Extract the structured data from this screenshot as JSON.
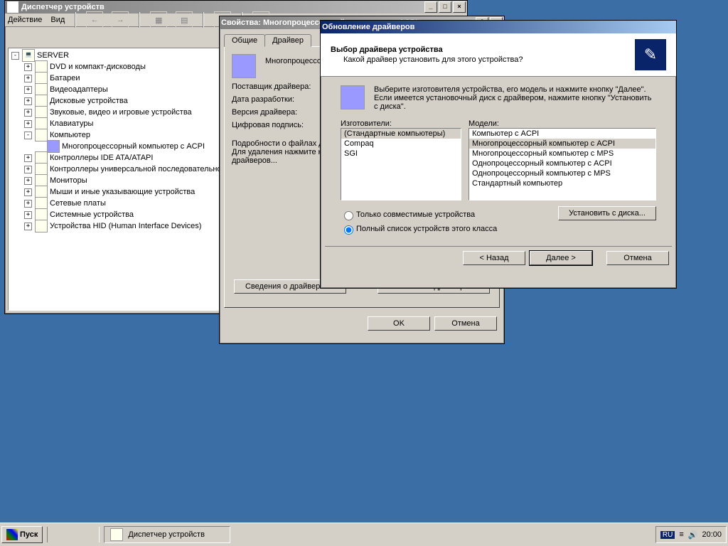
{
  "devmgr": {
    "title": "Диспетчер устройств",
    "menus": {
      "action": "Действие",
      "view": "Вид"
    },
    "root": "SERVER",
    "nodes": [
      {
        "label": "DVD и компакт-дисководы"
      },
      {
        "label": "Батареи"
      },
      {
        "label": "Видеоадаптеры"
      },
      {
        "label": "Дисковые устройства"
      },
      {
        "label": "Звуковые, видео и игровые устройства"
      },
      {
        "label": "Клавиатуры"
      },
      {
        "label": "Компьютер",
        "expanded": true,
        "child": "Многопроцессорный компьютер с ACPI"
      },
      {
        "label": "Контроллеры IDE ATA/ATAPI"
      },
      {
        "label": "Контроллеры универсальной последовательной шины USB"
      },
      {
        "label": "Мониторы"
      },
      {
        "label": "Мыши и иные указывающие устройства"
      },
      {
        "label": "Сетевые платы"
      },
      {
        "label": "Системные устройства"
      },
      {
        "label": "Устройства HID (Human Interface Devices)"
      }
    ]
  },
  "props": {
    "title": "Свойства: Многопроцессорный компьютер с ACPI",
    "tabs": {
      "general": "Общие",
      "driver": "Драйвер"
    },
    "device_name": "Многопроцессорный компьютер с ACPI",
    "fields": {
      "vendor": "Поставщик драйвера:",
      "date": "Дата разработки:",
      "version": "Версия драйвера:",
      "sig": "Цифровая подпись:"
    },
    "info_text": "Подробности о файлах драйверов — кнопка \"Сведения о драйверах\". Для удаления нажмите кнопку \"Удалить\". Обновить файлы драйверов...",
    "btn_details": "Сведения о драйверах...",
    "btn_update": "Обновить драйвер...",
    "ok": "OK",
    "cancel": "Отмена"
  },
  "wizard": {
    "title": "Обновление драйверов",
    "heading": "Выбор драйвера устройства",
    "subheading": "Какой драйвер установить для этого устройства?",
    "instruction": "Выберите изготовителя устройства, его модель и нажмите кнопку \"Далее\". Если имеется установочный диск с  драйвером, нажмите кнопку \"Установить с диска\".",
    "lbl_manufacturers": "Изготовители:",
    "lbl_models": "Модели:",
    "manufacturers": [
      "(Стандартные компьютеры)",
      "Compaq",
      "SGI"
    ],
    "models": [
      "Компьютер с ACPI",
      "Многопроцессорный компьютер с ACPI",
      "Многопроцессорный компьютер с MPS",
      "Однопроцессорный компьютер с ACPI",
      "Однопроцессорный компьютер с MPS",
      "Стандартный компьютер"
    ],
    "radio_compat": "Только совместимые устройства",
    "radio_all": "Полный список устройств этого класса",
    "btn_disk": "Установить с диска...",
    "back": "< Назад",
    "next": "Далее >",
    "cancel": "Отмена"
  },
  "taskbar": {
    "start": "Пуск",
    "task": "Диспетчер устройств",
    "lang": "RU",
    "time": "20:00"
  }
}
